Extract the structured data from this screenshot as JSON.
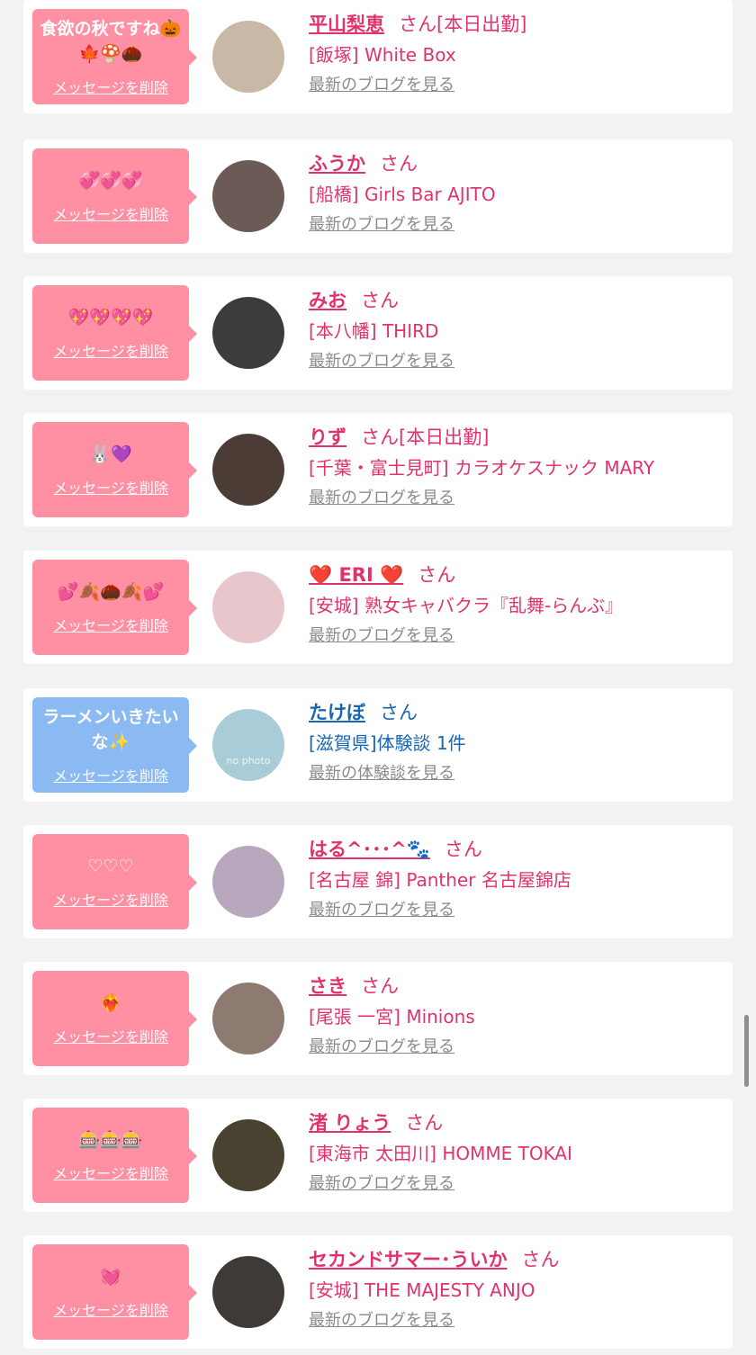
{
  "colors": {
    "bubble_pink": "#ff8fa3",
    "bubble_blue": "#8bbaf2",
    "text_pink": "#e0336e",
    "text_blue": "#1a66b3",
    "link_gray": "#8a8a8a"
  },
  "entries": [
    {
      "message": "食欲の秋ですね🎃🍁🍄🌰",
      "delete_label": "メッセージを削除",
      "name": "平山梨恵",
      "honorific": "さん",
      "status": "[本日出勤]",
      "shop": "[飯塚] White Box",
      "link": "最新のブログを見る",
      "theme": "pink",
      "avatar_color": "#c9b8a6"
    },
    {
      "message": "💞💞💞",
      "delete_label": "メッセージを削除",
      "name": "ふうか",
      "honorific": "さん",
      "status": "",
      "shop": "[船橋] Girls Bar AJITO",
      "link": "最新のブログを見る",
      "theme": "pink",
      "avatar_color": "#6b5a55"
    },
    {
      "message": "💖💖💖💖",
      "delete_label": "メッセージを削除",
      "name": "みお",
      "honorific": "さん",
      "status": "",
      "shop": "[本八幡] THIRD",
      "link": "最新のブログを見る",
      "theme": "pink",
      "avatar_color": "#3a3d3a"
    },
    {
      "message": "🐰💜",
      "delete_label": "メッセージを削除",
      "name": "りず",
      "honorific": "さん",
      "status": "[本日出勤]",
      "shop": "[千葉・富士見町] カラオケスナック MARY",
      "link": "最新のブログを見る",
      "theme": "pink",
      "avatar_color": "#4b3c36"
    },
    {
      "message": "💕🍂🌰🍂💕",
      "delete_label": "メッセージを削除",
      "name": "❤️ ERI ❤️",
      "honorific": "さん",
      "status": "",
      "shop": "[安城] 熟女キャバクラ『乱舞-らんぶ』",
      "link": "最新のブログを見る",
      "theme": "pink",
      "avatar_color": "#e8c7cc"
    },
    {
      "message": "ラーメンいきたいな✨",
      "delete_label": "メッセージを削除",
      "name": "たけぼ",
      "honorific": "さん",
      "status": "",
      "shop": "[滋賀県]体験談 1件",
      "link": "最新の体験談を見る",
      "theme": "blue",
      "avatar_color": "#a9cdd8",
      "avatar_text": "no photo"
    },
    {
      "message": "♡♡♡",
      "delete_label": "メッセージを削除",
      "name": "はる^･･･^🐾",
      "honorific": "さん",
      "status": "",
      "shop": "[名古屋 錦] Panther 名古屋錦店",
      "link": "最新のブログを見る",
      "theme": "pink",
      "avatar_color": "#b9a7bd"
    },
    {
      "message": "❤️‍🔥",
      "delete_label": "メッセージを削除",
      "name": "さき",
      "honorific": "さん",
      "status": "",
      "shop": "[尾張 一宮] Minions",
      "link": "最新のブログを見る",
      "theme": "pink",
      "avatar_color": "#8d7a70"
    },
    {
      "message": "🎰🎰🎰",
      "delete_label": "メッセージを削除",
      "name": "渚 りょう",
      "honorific": "さん",
      "status": "",
      "shop": "[東海市 太田川] HOMME TOKAI",
      "link": "最新のブログを見る",
      "theme": "pink",
      "avatar_color": "#4a4230"
    },
    {
      "message": "💓",
      "delete_label": "メッセージを削除",
      "name": "セカンドサマー･ういか",
      "honorific": "さん",
      "status": "",
      "shop": "[安城] THE MAJESTY ANJO",
      "link": "最新のブログを見る",
      "theme": "pink",
      "avatar_color": "#3f3a36"
    }
  ]
}
